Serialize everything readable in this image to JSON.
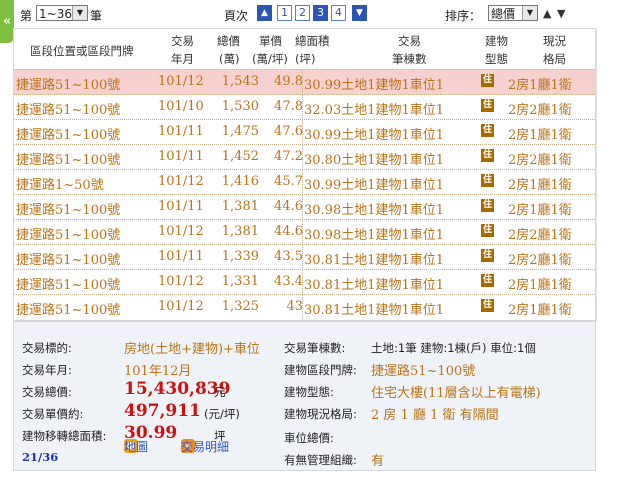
{
  "sidetab": {
    "glyph": "«"
  },
  "topbar": {
    "no_label": "第",
    "range_value": "1~36",
    "bi_label": "筆",
    "pager_label": "頁次",
    "pages": [
      "1",
      "2",
      "3",
      "4"
    ],
    "current_page": "3",
    "sort_label": "排序：",
    "sort_value": "總價"
  },
  "columns": {
    "addr": "區段位置或區段門牌",
    "ym1": "交易",
    "ym2": "年月",
    "tot1": "總價",
    "tot2": "(萬)",
    "unit1": "單價",
    "unit2": "(萬/坪)",
    "area1": "總面積",
    "area2": "(坪)",
    "tx1": "交易",
    "tx2": "筆棟數",
    "type1": "建物",
    "type2": "型態",
    "lay1": "現況",
    "lay2": "格局"
  },
  "rows": [
    {
      "addr": "捷運路51~100號",
      "ym": "101/12",
      "total": "1,543",
      "unit": "49.8",
      "area": "30.99",
      "tx": "土地1建物1車位1",
      "type": "住",
      "layout": "2房1廳1衛"
    },
    {
      "addr": "捷運路51~100號",
      "ym": "101/10",
      "total": "1,530",
      "unit": "47.8",
      "area": "32.03",
      "tx": "土地1建物1車位1",
      "type": "住",
      "layout": "2房2廳1衛"
    },
    {
      "addr": "捷運路51~100號",
      "ym": "101/11",
      "total": "1,475",
      "unit": "47.6",
      "area": "30.99",
      "tx": "土地1建物1車位1",
      "type": "住",
      "layout": "2房1廳1衛"
    },
    {
      "addr": "捷運路51~100號",
      "ym": "101/11",
      "total": "1,452",
      "unit": "47.2",
      "area": "30.80",
      "tx": "土地1建物1車位1",
      "type": "住",
      "layout": "2房2廳1衛"
    },
    {
      "addr": "捷運路1~50號",
      "ym": "101/12",
      "total": "1,416",
      "unit": "45.7",
      "area": "30.99",
      "tx": "土地1建物1車位1",
      "type": "住",
      "layout": "2房1廳1衛"
    },
    {
      "addr": "捷運路51~100號",
      "ym": "101/11",
      "total": "1,381",
      "unit": "44.6",
      "area": "30.98",
      "tx": "土地1建物1車位1",
      "type": "住",
      "layout": "2房1廳1衛"
    },
    {
      "addr": "捷運路51~100號",
      "ym": "101/12",
      "total": "1,381",
      "unit": "44.6",
      "area": "30.98",
      "tx": "土地1建物1車位1",
      "type": "住",
      "layout": "2房2廳1衛"
    },
    {
      "addr": "捷運路51~100號",
      "ym": "101/11",
      "total": "1,339",
      "unit": "43.5",
      "area": "30.81",
      "tx": "土地1建物1車位1",
      "type": "住",
      "layout": "2房2廳1衛"
    },
    {
      "addr": "捷運路51~100號",
      "ym": "101/12",
      "total": "1,331",
      "unit": "43.4",
      "area": "30.81",
      "tx": "土地1建物1車位1",
      "type": "住",
      "layout": "2房1廳1衛"
    },
    {
      "addr": "捷運路51~100號",
      "ym": "101/12",
      "total": "1,325",
      "unit": "43",
      "area": "30.81",
      "tx": "土地1建物1車位1",
      "type": "住",
      "layout": "2房1廳1衛"
    }
  ],
  "detail": {
    "target_label": "交易標的:",
    "target_value": "房地(土地+建物)+車位",
    "ym_label": "交易年月:",
    "ym_value": "101年12月",
    "total_label": "交易總價:",
    "total_value": "15,430,839",
    "total_unit": "元",
    "unit_label": "交易單價約:",
    "unit_value": "497,911",
    "unit_unit": "(元/坪)",
    "area_label": "建物移轉總面積:",
    "area_value": "30.99",
    "area_unit": "坪",
    "index": "21/36",
    "map_label": "地圖",
    "txdetail_label": "交易明細",
    "tx_label": "交易筆棟數:",
    "tx_value": "土地:1筆 建物:1棟(戶) 車位:1個",
    "addr_label": "建物區段門牌:",
    "addr_value": "捷運路51~100號",
    "type_label": "建物型態:",
    "type_value": "住宅大樓(11層含以上有電梯)",
    "layout_label": "建物現況格局:",
    "layout_value": "2 房 1 廳 1 衛 有隔間",
    "parking_label": "車位總價:",
    "mgmt_label": "有無管理組織:",
    "mgmt_value": "有"
  }
}
